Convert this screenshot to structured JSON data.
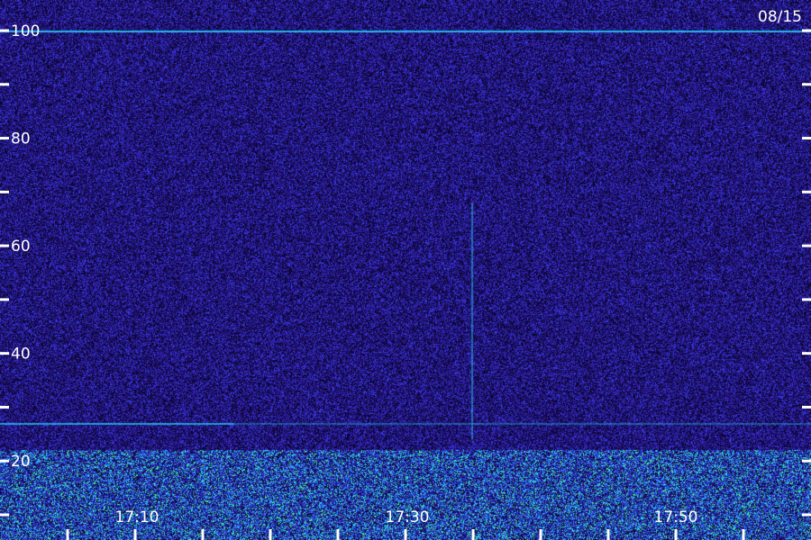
{
  "date_label": "08/15",
  "colors": {
    "background": "#1a0f5a",
    "noise_low": "#2a1fb0",
    "noise_mid": "#3f4cff",
    "signal_cyan": "#27d6ff",
    "signal_green": "#48ff7a",
    "axis": "#ffffff"
  },
  "chart_data": {
    "type": "heatmap",
    "title": "",
    "xlabel": "",
    "ylabel": "",
    "ylim": [
      10,
      100
    ],
    "y_ticks_labeled": [
      "20",
      "40",
      "60",
      "80",
      "100"
    ],
    "y_ticks_unlabeled": [
      10,
      30,
      50,
      70,
      90
    ],
    "x_ticks_labeled": [
      "17:10",
      "17:30",
      "17:50"
    ],
    "x_ticks_unlabeled_count": 12,
    "grid": false,
    "legend": "none",
    "features": [
      {
        "kind": "horizontal-line",
        "y": 100
      },
      {
        "kind": "horizontal-line",
        "y": 27
      },
      {
        "kind": "vertical-line",
        "x": "17:35"
      },
      {
        "kind": "band",
        "y_range": [
          10,
          22
        ]
      }
    ]
  }
}
